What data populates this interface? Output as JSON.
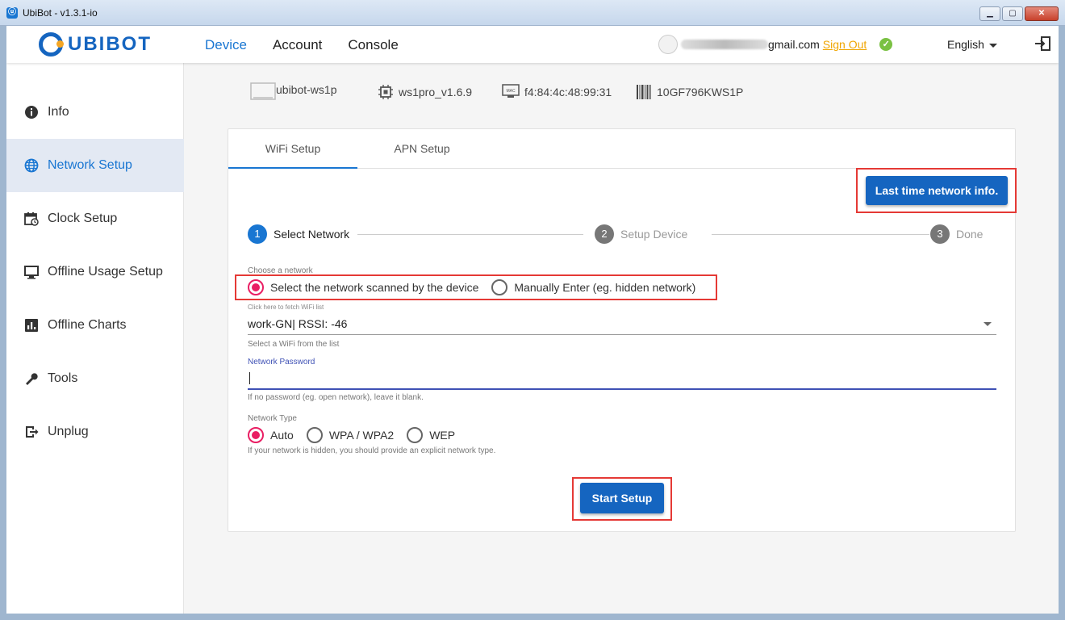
{
  "window": {
    "title": "UbiBot - v1.3.1-io",
    "controls": [
      "minimize",
      "maximize",
      "close"
    ]
  },
  "header": {
    "logo_text": "UBIBOT",
    "nav": [
      "Device",
      "Account",
      "Console"
    ],
    "user_email": "gmail.com",
    "sign_out": "Sign Out",
    "language": "English"
  },
  "sidebar": {
    "items": [
      {
        "label": "Info",
        "icon": "info-icon"
      },
      {
        "label": "Network Setup",
        "icon": "globe-icon"
      },
      {
        "label": "Clock Setup",
        "icon": "calendar-clock-icon"
      },
      {
        "label": "Offline Usage Setup",
        "icon": "monitor-icon"
      },
      {
        "label": "Offline Charts",
        "icon": "bar-chart-icon"
      },
      {
        "label": "Tools",
        "icon": "wrench-icon"
      },
      {
        "label": "Unplug",
        "icon": "exit-icon"
      }
    ],
    "active": "Network Setup"
  },
  "device": {
    "name": "ubibot-ws1p",
    "firmware": "ws1pro_v1.6.9",
    "mac": "f4:84:4c:48:99:31",
    "serial": "10GF796KWS1P",
    "mac_icon_label": "MAC"
  },
  "tabs": [
    "WiFi Setup",
    "APN Setup"
  ],
  "last_network_button": "Last time network info.",
  "steps": [
    {
      "num": "1",
      "label": "Select Network"
    },
    {
      "num": "2",
      "label": "Setup Device"
    },
    {
      "num": "3",
      "label": "Done"
    }
  ],
  "form": {
    "choose_label": "Choose a network",
    "network_options": [
      "Select the network scanned by the device",
      "Manually Enter (eg. hidden network)"
    ],
    "fetch_hint": "Click here to fetch WiFi list",
    "selected_wifi": "work-GN| RSSI: -46",
    "select_hint": "Select a WiFi from the list",
    "password_label": "Network Password",
    "password_value": "",
    "password_hint": "If no password (eg. open network), leave it blank.",
    "type_label": "Network Type",
    "type_options": [
      "Auto",
      "WPA / WPA2",
      "WEP"
    ],
    "type_hint": "If your network is hidden, you should provide an explicit network type."
  },
  "start_button": "Start Setup",
  "colors": {
    "accent": "#1976d2",
    "button": "#1565c0",
    "radio_on": "#e91e63",
    "highlight": "#e53935",
    "sign_out": "#f0a500"
  }
}
